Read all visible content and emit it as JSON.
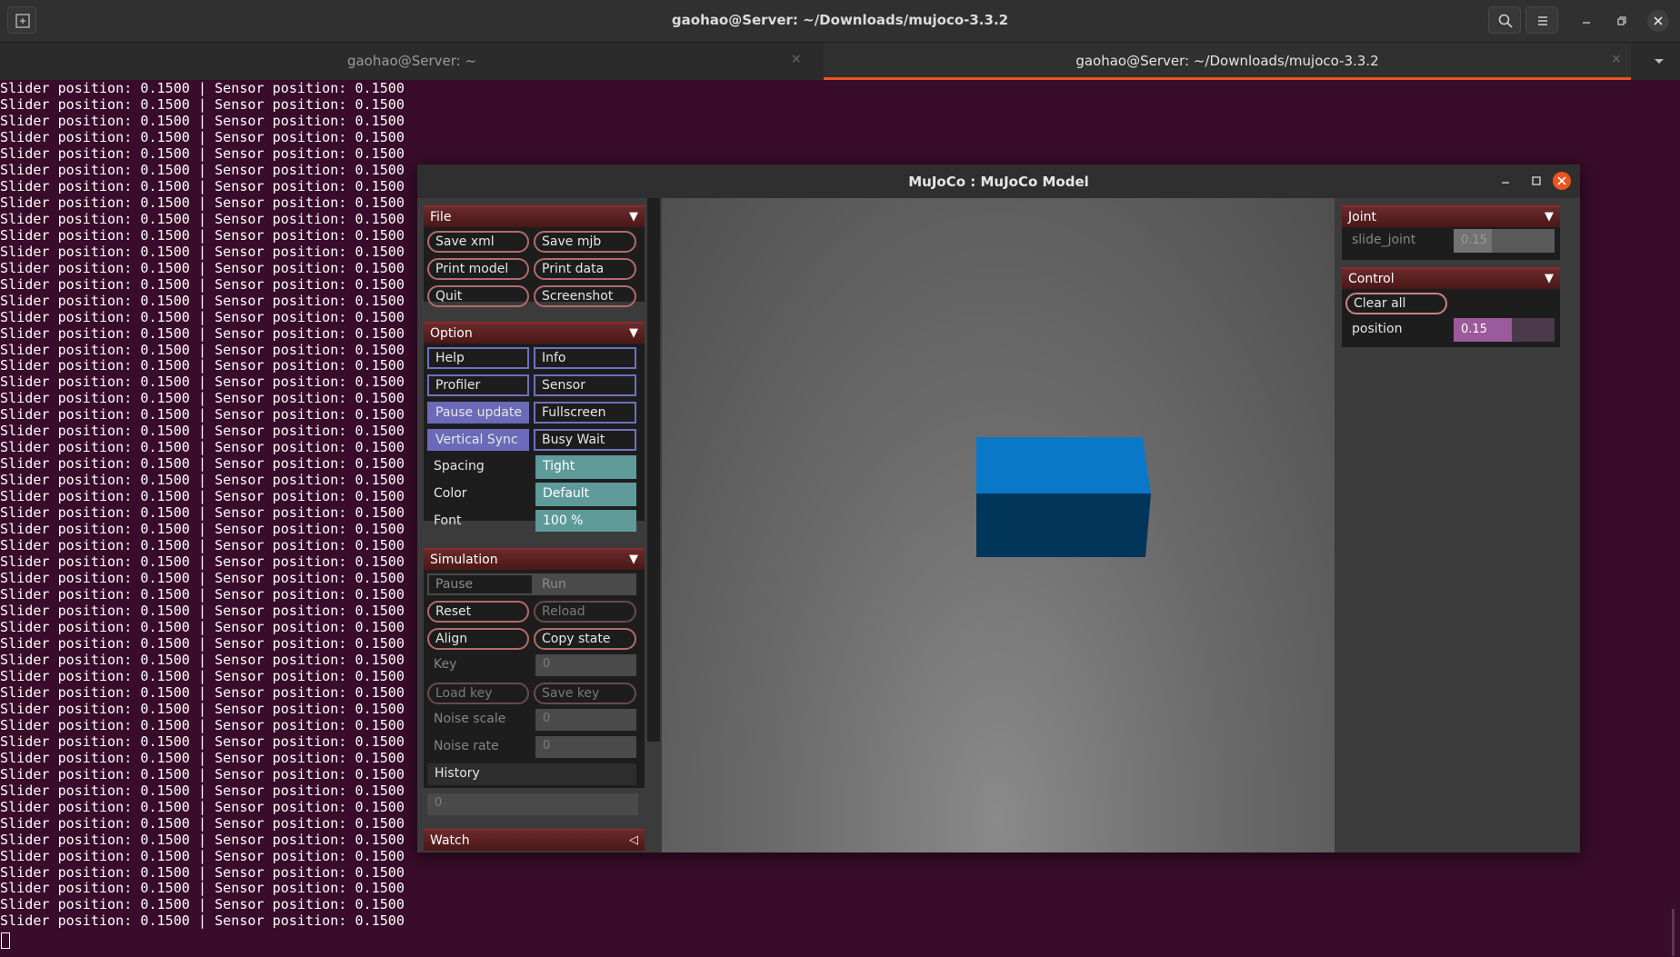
{
  "terminal": {
    "title": "gaohao@Server: ~/Downloads/mujoco-3.3.2",
    "tabs": [
      {
        "label": "gaohao@Server: ~",
        "active": false
      },
      {
        "label": "gaohao@Server: ~/Downloads/mujoco-3.3.2",
        "active": true
      }
    ],
    "tab_close_glyph": "×",
    "output_line": "Slider position: 0.1500 | Sensor position: 0.1500",
    "line_count": 52,
    "icons": [
      "new-tab-icon",
      "search-icon",
      "hamburger-menu-icon",
      "minimize-icon",
      "restore-icon",
      "close-icon",
      "tab-list-chevron-icon"
    ]
  },
  "mujoco": {
    "title": "MuJoCo : MuJoCo Model",
    "file": {
      "header": "File",
      "buttons": [
        "Save xml",
        "Save mjb",
        "Print model",
        "Print data",
        "Quit",
        "Screenshot"
      ]
    },
    "option": {
      "header": "Option",
      "checks": [
        {
          "label": "Help",
          "on": false
        },
        {
          "label": "Info",
          "on": false
        },
        {
          "label": "Profiler",
          "on": false
        },
        {
          "label": "Sensor",
          "on": false
        },
        {
          "label": "Pause update",
          "on": true
        },
        {
          "label": "Fullscreen",
          "on": false
        },
        {
          "label": "Vertical Sync",
          "on": true
        },
        {
          "label": "Busy Wait",
          "on": false
        }
      ],
      "spacing_label": "Spacing",
      "spacing_value": "Tight",
      "color_label": "Color",
      "color_value": "Default",
      "font_label": "Font",
      "font_value": "100 %"
    },
    "simulation": {
      "header": "Simulation",
      "pause": "Pause",
      "run": "Run",
      "reset": "Reset",
      "reload": "Reload",
      "align": "Align",
      "copy_state": "Copy state",
      "key_label": "Key",
      "key_value": "0",
      "load_key": "Load key",
      "save_key": "Save key",
      "noise_scale_label": "Noise scale",
      "noise_scale_value": "0",
      "noise_rate_label": "Noise rate",
      "noise_rate_value": "0",
      "history_label": "History",
      "history_value": "0"
    },
    "watch": {
      "header": "Watch"
    },
    "joint": {
      "header": "Joint",
      "name": "slide_joint",
      "value": "0.15",
      "level": 0.38
    },
    "control": {
      "header": "Control",
      "clear_all": "Clear all",
      "name": "position",
      "value": "0.15",
      "level": 0.58
    },
    "colors": {
      "box_top": "#0a78c8",
      "box_front": "#02355a",
      "section_header": "#5a1e1e",
      "accent_orange": "#e95420",
      "terminal_bg": "#380c2a"
    }
  }
}
